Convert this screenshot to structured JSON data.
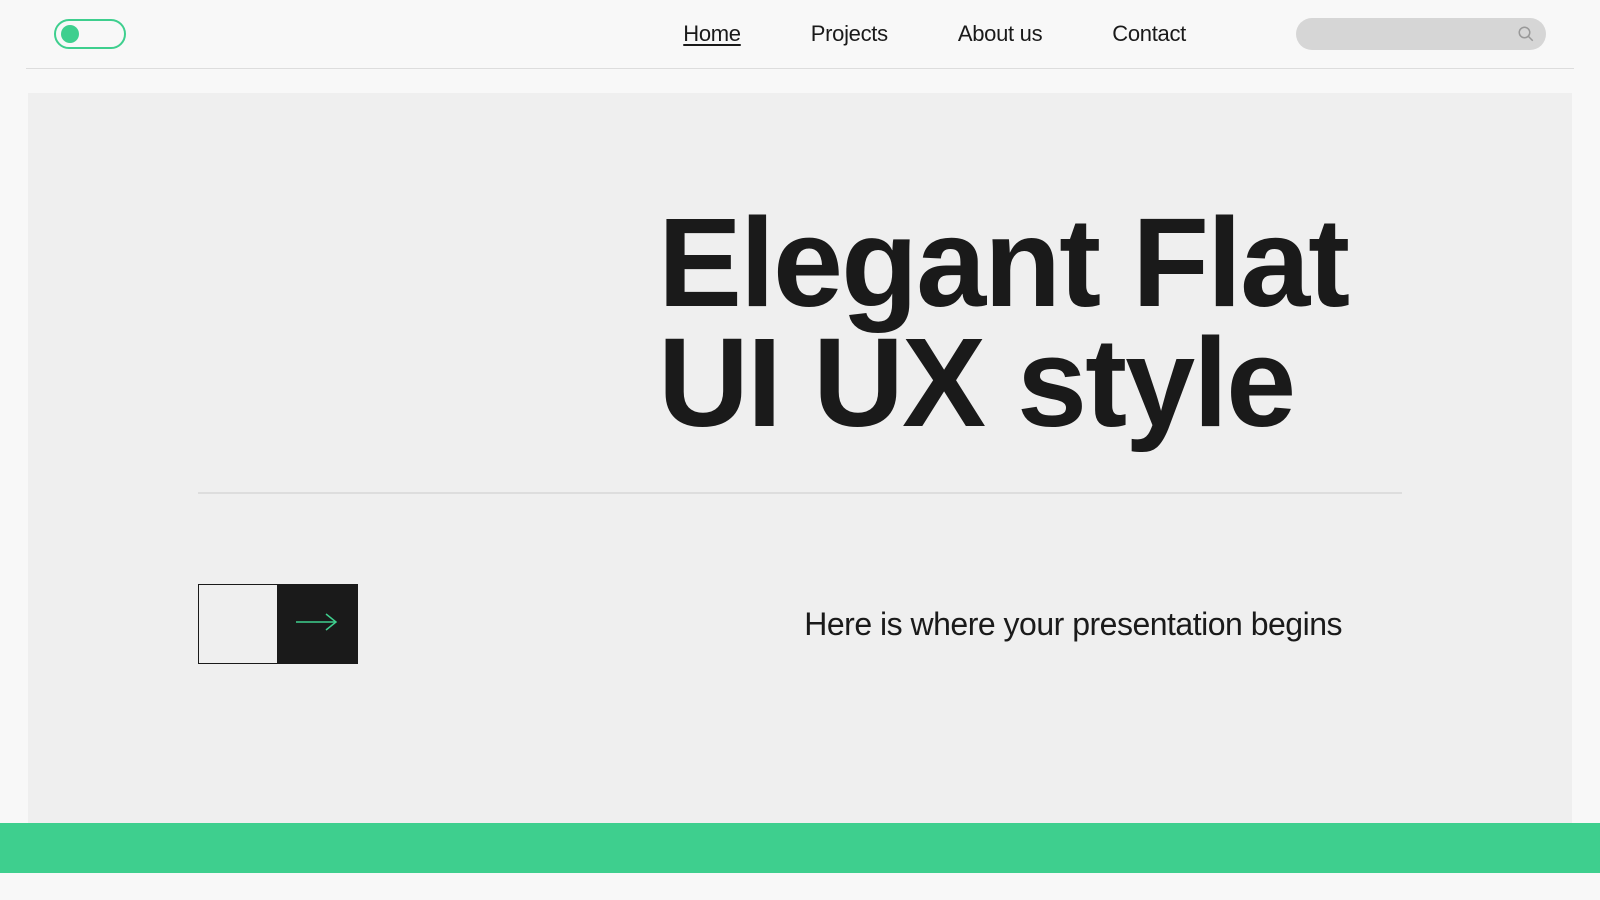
{
  "nav": {
    "home": "Home",
    "projects": "Projects",
    "about": "About us",
    "contact": "Contact"
  },
  "hero": {
    "title_line1": "Elegant Flat",
    "title_line2": "UI UX style",
    "subtitle": "Here is where your presentation begins"
  },
  "colors": {
    "accent": "#3ecf8e",
    "dark": "#1a1a1a"
  }
}
